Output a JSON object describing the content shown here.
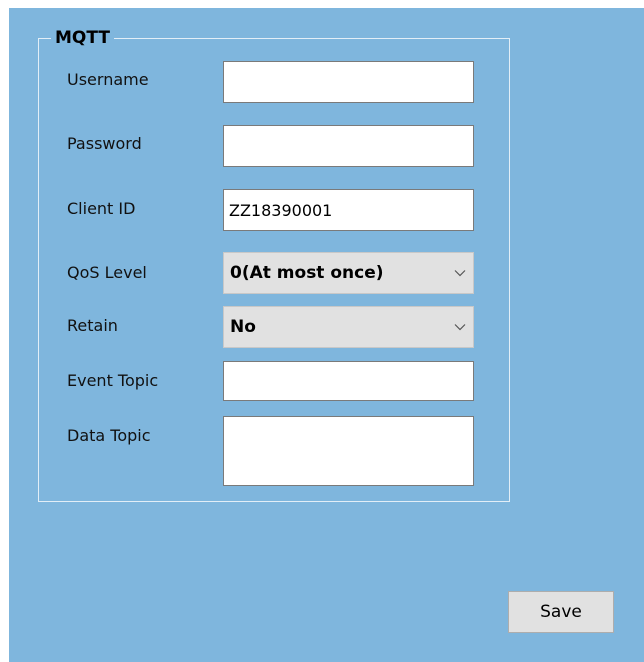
{
  "mqtt": {
    "title": "MQTT",
    "fields": {
      "username": {
        "label": "Username",
        "value": ""
      },
      "password": {
        "label": "Password",
        "value": ""
      },
      "client_id": {
        "label": "Client ID",
        "value": "ZZ18390001"
      },
      "qos_level": {
        "label": "QoS Level",
        "value": "0(At most once)"
      },
      "retain": {
        "label": "Retain",
        "value": "No"
      },
      "event_topic": {
        "label": "Event Topic",
        "value": ""
      },
      "data_topic": {
        "label": "Data Topic",
        "value": ""
      }
    }
  },
  "save_label": "Save",
  "icons": {
    "dropdown": "chevron-down-icon"
  },
  "colors": {
    "panel_background": "#7fb6dd",
    "button_background": "#e1e1e1"
  }
}
